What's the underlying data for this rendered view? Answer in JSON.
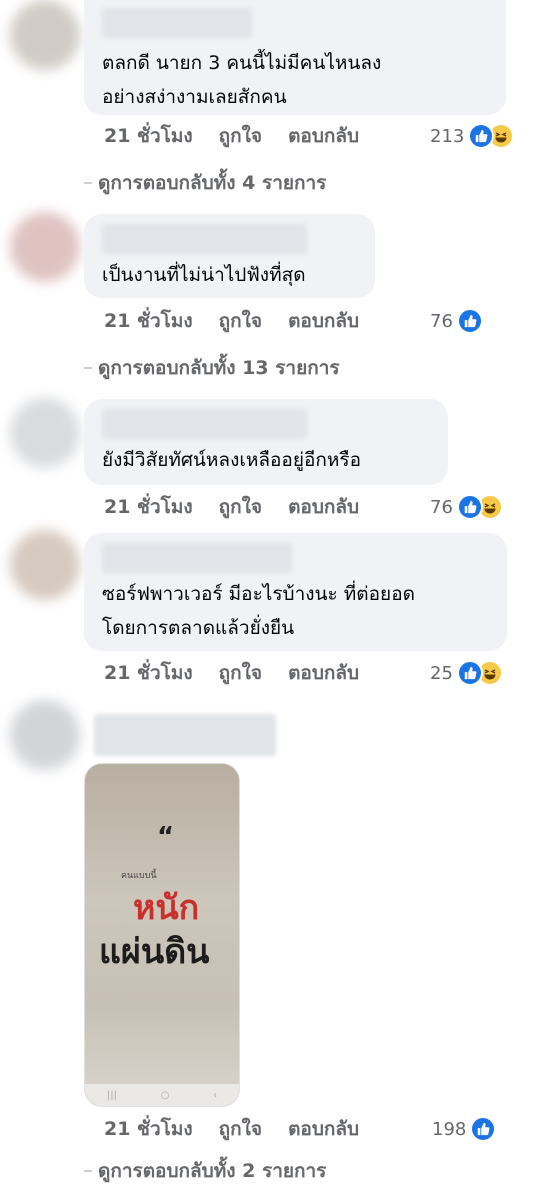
{
  "colors": {
    "like": "#1b74e4",
    "haha": "#f7c948",
    "bubble": "#f0f2f5",
    "meta": "#65676b"
  },
  "actions": {
    "time": "21 ชั่วโมง",
    "like": "ถูกใจ",
    "reply": "ตอบกลับ"
  },
  "comments": [
    {
      "text": "ตลกดี นายก 3 คนนี้ไม่มีคนไหนลง\nอย่างสง่างามเลยสักคน",
      "reaction_count": "213",
      "view_replies": "ดูการตอบกลับทั้ง 4 รายการ"
    },
    {
      "text": "เป็นงานที่ไม่น่าไปฟังที่สุด",
      "reaction_count": "76",
      "view_replies": "ดูการตอบกลับทั้ง 13 รายการ"
    },
    {
      "text": "ยังมีวิสัยทัศน์หลงเหลืออยู่อีกหรือ",
      "reaction_count": "76"
    },
    {
      "text": "ซอร์ฟพาวเวอร์ มีอะไรบ้างนะ ที่ต่อยอด\nโดยการตลาดแล้วยั่งยืน",
      "reaction_count": "25"
    },
    {
      "reaction_count": "198",
      "view_replies": "ดูการตอบกลับทั้ง 2 รายการ"
    }
  ],
  "photo": {
    "quote_mark": "“",
    "small_text": "คนแบบนี้",
    "red_text": "หนัก",
    "black_text": "แผ่นดิน",
    "nav_icons": [
      "|||",
      "○",
      "‹"
    ]
  }
}
